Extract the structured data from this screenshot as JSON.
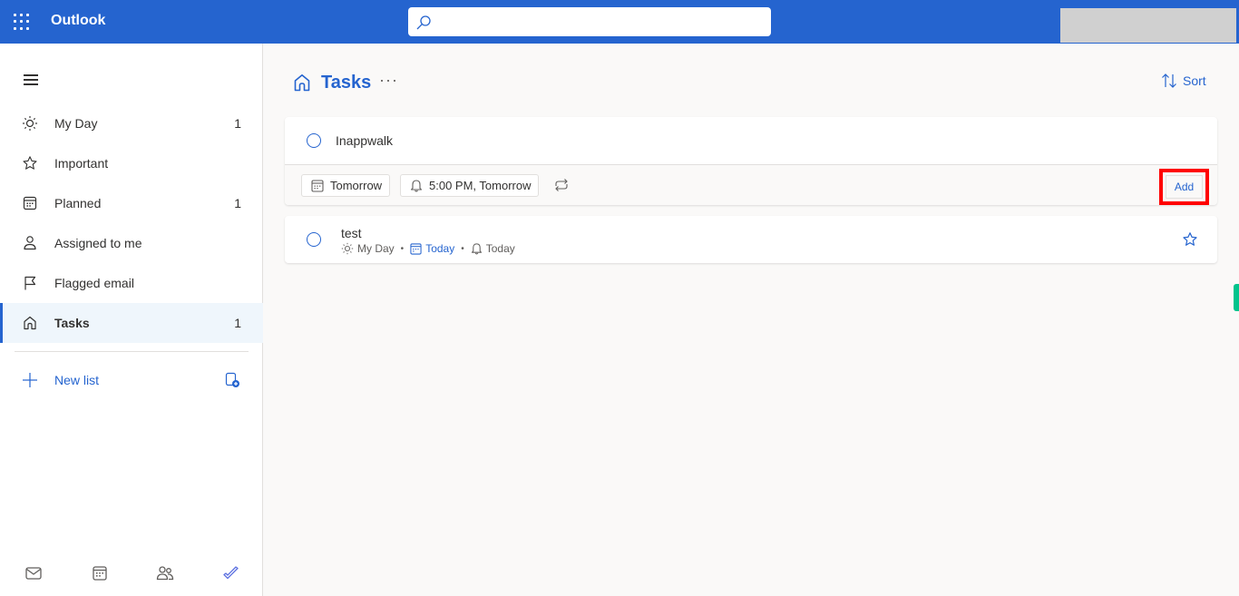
{
  "topbar": {
    "app_name": "Outlook",
    "search_placeholder": "",
    "search_value": ""
  },
  "sidebar": {
    "items": [
      {
        "label": "My Day",
        "count": "1",
        "icon": "sun-icon"
      },
      {
        "label": "Important",
        "count": "",
        "icon": "star-icon"
      },
      {
        "label": "Planned",
        "count": "1",
        "icon": "calendar-icon"
      },
      {
        "label": "Assigned to me",
        "count": "",
        "icon": "person-icon"
      },
      {
        "label": "Flagged email",
        "count": "",
        "icon": "flag-icon"
      },
      {
        "label": "Tasks",
        "count": "1",
        "icon": "home-icon",
        "active": true
      }
    ],
    "new_list_label": "New list",
    "bottom_apps": [
      "mail-icon",
      "calendar-icon",
      "people-icon",
      "todo-check-icon"
    ]
  },
  "main": {
    "title": "Tasks",
    "more_label": "···",
    "sort_label": "Sort",
    "accent_color": "#2564cf",
    "add_task": {
      "value": "Inappwalk",
      "due_chip": "Tomorrow",
      "reminder_chip": "5:00 PM, Tomorrow",
      "add_button": "Add",
      "highlight_color": "#ff0000"
    },
    "tasks": [
      {
        "title": "test",
        "my_day": "My Day",
        "due": "Today",
        "reminder": "Today",
        "separator": "•"
      }
    ]
  }
}
